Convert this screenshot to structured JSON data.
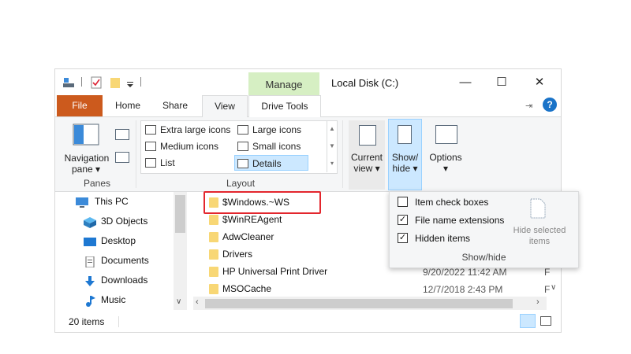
{
  "window": {
    "manage_tab": "Manage",
    "title": "Local Disk (C:)",
    "minimize": "—",
    "maximize": "☐",
    "close": "✕"
  },
  "tabs": {
    "file": "File",
    "home": "Home",
    "share": "Share",
    "view": "View",
    "drive_tools": "Drive Tools"
  },
  "ribbon": {
    "panes": {
      "nav_pane_line1": "Navigation",
      "nav_pane_line2": "pane",
      "group_label": "Panes"
    },
    "layout": {
      "items": [
        "Extra large icons",
        "Large icons",
        "Medium icons",
        "Small icons",
        "List",
        "Details"
      ],
      "selected": "Details",
      "group_label": "Layout"
    },
    "current_view": {
      "line1": "Current",
      "line2": "view"
    },
    "show_hide": {
      "line1": "Show/",
      "line2": "hide"
    },
    "options": {
      "label": "Options"
    }
  },
  "nav_pane": {
    "items": [
      "This PC",
      "3D Objects",
      "Desktop",
      "Documents",
      "Downloads",
      "Music"
    ]
  },
  "files": [
    {
      "name": "$Windows.~WS",
      "date": ""
    },
    {
      "name": "$WinREAgent",
      "date": ""
    },
    {
      "name": "AdwCleaner",
      "date": ""
    },
    {
      "name": "Drivers",
      "date": ""
    },
    {
      "name": "HP Universal Print Driver",
      "date": "9/20/2022 11:42 AM"
    },
    {
      "name": "MSOCache",
      "date": "12/7/2018 2:43 PM"
    }
  ],
  "status": {
    "item_count": "20 items"
  },
  "show_hide_menu": {
    "options": [
      {
        "label": "Item check boxes",
        "checked": false
      },
      {
        "label": "File name extensions",
        "checked": true
      },
      {
        "label": "Hidden items",
        "checked": true
      }
    ],
    "hide_selected_line1": "Hide selected",
    "hide_selected_line2": "items",
    "group_label": "Show/hide"
  },
  "colors": {
    "file_tab": "#cc5a1d",
    "manage_tab": "#d6efc3",
    "highlight": "#e3262d",
    "selected": "#cce8ff"
  }
}
